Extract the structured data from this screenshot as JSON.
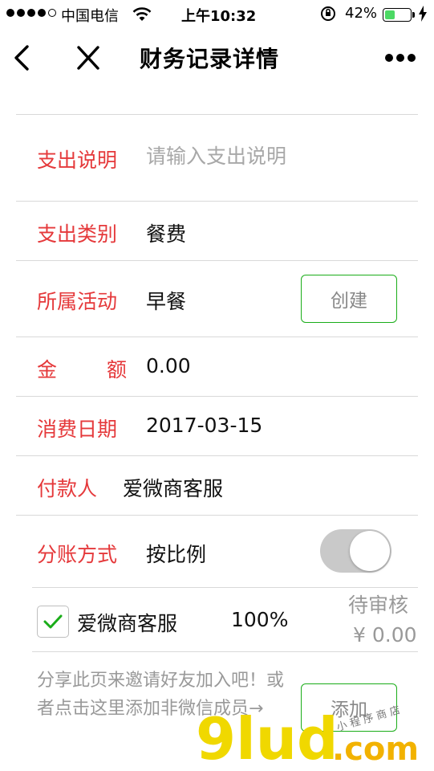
{
  "status_bar": {
    "carrier": "中国电信",
    "time": "上午10:32",
    "battery_percent": "42%",
    "battery_level": 0.42,
    "signal_bars_filled": 4,
    "signal_bars_total": 5
  },
  "nav": {
    "title": "财务记录详情",
    "back_icon": "chevron-left-icon",
    "close_icon": "close-icon",
    "more_icon": "more-dots-icon"
  },
  "form": {
    "description": {
      "label": "支出说明",
      "placeholder": "请输入支出说明",
      "value": ""
    },
    "category": {
      "label": "支出类别",
      "value": "餐费"
    },
    "activity": {
      "label": "所属活动",
      "value": "早餐",
      "create_button": "创建"
    },
    "amount": {
      "label_char1": "金",
      "label_char2": "额",
      "value": "0.00"
    },
    "date": {
      "label": "消费日期",
      "value": "2017-03-15"
    },
    "payer": {
      "label": "付款人",
      "value": "爱微商客服"
    },
    "split": {
      "label": "分账方式",
      "value": "按比例",
      "toggle_on": false
    }
  },
  "member": {
    "checked": true,
    "name": "爱微商客服",
    "percent": "100%",
    "status": "待审核",
    "amount": "¥ 0.00"
  },
  "footer": {
    "hint": "分享此页来邀请好友加入吧！或者点击这里添加非微信成员→",
    "add_button": "添加"
  },
  "watermark": {
    "main": "9lud",
    "domain": ".com",
    "tagline": "小 程 序 商 店"
  },
  "colors": {
    "label": "#e5393b",
    "accent_green": "#1aad19",
    "toggle_off": "#c9c9c9",
    "battery": "#4cd964"
  }
}
